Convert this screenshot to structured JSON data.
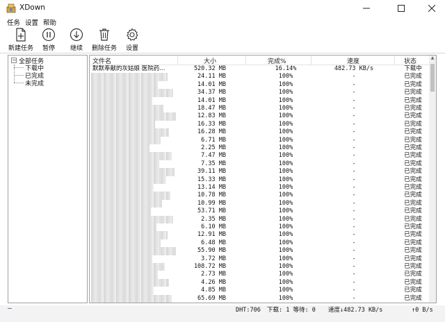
{
  "window": {
    "title": "XDown"
  },
  "menu": [
    "任务",
    "设置",
    "帮助"
  ],
  "toolbar": {
    "new_label": "新建任务",
    "pause_label": "暂停",
    "resume_label": "继续",
    "delete_label": "删除任务",
    "settings_label": "设置"
  },
  "tree": {
    "root": "全部任务",
    "children": [
      "下载中",
      "已完成",
      "未完成"
    ]
  },
  "list": {
    "columns": [
      "文件名",
      "大小",
      "完成%",
      "速度",
      "状态"
    ],
    "rows": [
      {
        "name": "默默奉献的灰姑娘 医院药...",
        "size": "520.32 MB",
        "progress": "16.14%",
        "speed": "482.73 KB/s",
        "status": "下载中"
      },
      {
        "name": "",
        "size": "24.11 MB",
        "progress": "100%",
        "speed": "-",
        "status": "已完成"
      },
      {
        "name": "",
        "size": "14.01 MB",
        "progress": "100%",
        "speed": "-",
        "status": "已完成"
      },
      {
        "name": "",
        "size": "34.37 MB",
        "progress": "100%",
        "speed": "-",
        "status": "已完成"
      },
      {
        "name": "",
        "size": "14.01 MB",
        "progress": "100%",
        "speed": "-",
        "status": "已完成"
      },
      {
        "name": "",
        "size": "18.47 MB",
        "progress": "100%",
        "speed": "-",
        "status": "已完成"
      },
      {
        "name": "",
        "size": "12.83 MB",
        "progress": "100%",
        "speed": "-",
        "status": "已完成"
      },
      {
        "name": "",
        "size": "16.33 MB",
        "progress": "100%",
        "speed": "-",
        "status": "已完成"
      },
      {
        "name": "",
        "size": "16.28 MB",
        "progress": "100%",
        "speed": "-",
        "status": "已完成"
      },
      {
        "name": "",
        "size": "6.71 MB",
        "progress": "100%",
        "speed": "-",
        "status": "已完成"
      },
      {
        "name": "",
        "size": "2.25 MB",
        "progress": "100%",
        "speed": "-",
        "status": "已完成"
      },
      {
        "name": "",
        "size": "7.47 MB",
        "progress": "100%",
        "speed": "-",
        "status": "已完成"
      },
      {
        "name": "",
        "size": "7.35 MB",
        "progress": "100%",
        "speed": "-",
        "status": "已完成"
      },
      {
        "name": "",
        "size": "39.11 MB",
        "progress": "100%",
        "speed": "-",
        "status": "已完成"
      },
      {
        "name": "",
        "size": "15.33 MB",
        "progress": "100%",
        "speed": "-",
        "status": "已完成"
      },
      {
        "name": "",
        "size": "13.14 MB",
        "progress": "100%",
        "speed": "-",
        "status": "已完成"
      },
      {
        "name": "",
        "size": "10.78 MB",
        "progress": "100%",
        "speed": "-",
        "status": "已完成"
      },
      {
        "name": "",
        "size": "10.99 MB",
        "progress": "100%",
        "speed": "-",
        "status": "已完成"
      },
      {
        "name": "",
        "size": "53.71 MB",
        "progress": "100%",
        "speed": "-",
        "status": "已完成"
      },
      {
        "name": "",
        "size": "2.35 MB",
        "progress": "100%",
        "speed": "-",
        "status": "已完成"
      },
      {
        "name": "",
        "size": "6.10 MB",
        "progress": "100%",
        "speed": "-",
        "status": "已完成"
      },
      {
        "name": "",
        "size": "12.91 MB",
        "progress": "100%",
        "speed": "-",
        "status": "已完成"
      },
      {
        "name": "",
        "size": "6.48 MB",
        "progress": "100%",
        "speed": "-",
        "status": "已完成"
      },
      {
        "name": "",
        "size": "55.90 MB",
        "progress": "100%",
        "speed": "-",
        "status": "已完成"
      },
      {
        "name": "",
        "size": "3.72 MB",
        "progress": "100%",
        "speed": "-",
        "status": "已完成"
      },
      {
        "name": "",
        "size": "108.72 MB",
        "progress": "100%",
        "speed": "-",
        "status": "已完成"
      },
      {
        "name": "",
        "size": "2.73 MB",
        "progress": "100%",
        "speed": "-",
        "status": "已完成"
      },
      {
        "name": "",
        "size": "4.26 MB",
        "progress": "100%",
        "speed": "-",
        "status": "已完成"
      },
      {
        "name": "",
        "size": "4.85 MB",
        "progress": "100%",
        "speed": "-",
        "status": "已完成"
      },
      {
        "name": "",
        "size": "65.69 MB",
        "progress": "100%",
        "speed": "-",
        "status": "已完成"
      }
    ]
  },
  "status_bar": {
    "dht": "DHT:706",
    "counts": "下载: 1 等待: 0",
    "download_speed": "速度↓482.73 KB/s",
    "upload_speed": "↑0 B/s"
  },
  "colors": {
    "accent": "#4a7ac7",
    "icon_stroke": "#333333"
  }
}
